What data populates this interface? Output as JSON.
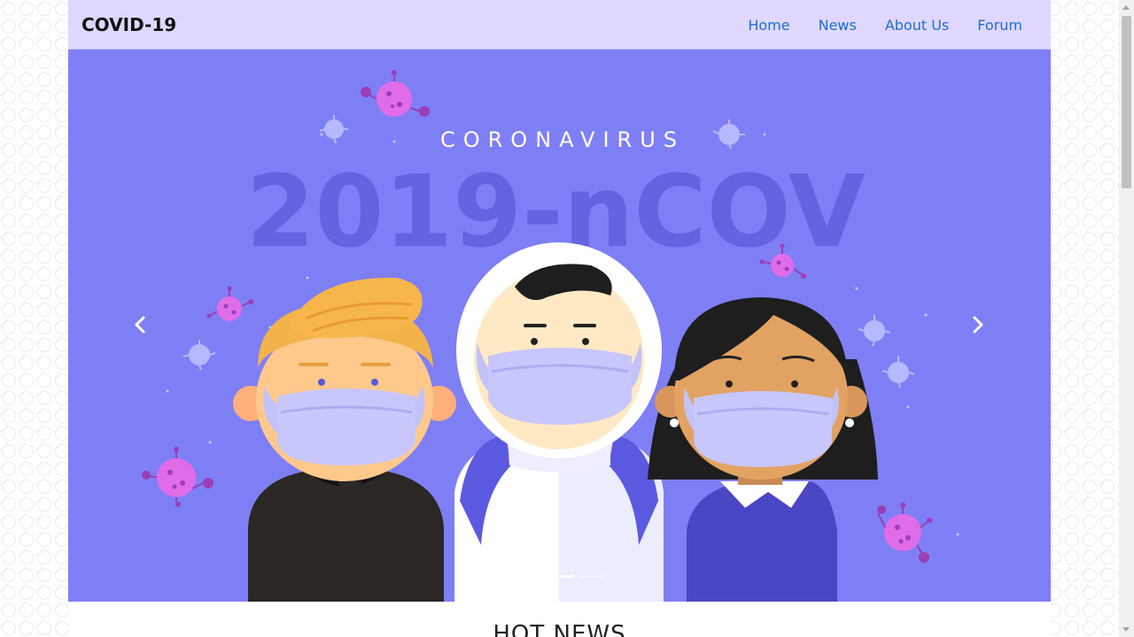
{
  "navbar": {
    "brand": "COVID-19",
    "links": [
      "Home",
      "News",
      "About Us",
      "Forum"
    ]
  },
  "hero": {
    "subtitle": "CORONAVIRUS",
    "headline": "2019-nCOV",
    "prev_icon": "chevron-left-icon",
    "next_icon": "chevron-right-icon",
    "slide_count": 3,
    "active_slide": 1
  },
  "section": {
    "title": "HOT NEWS"
  },
  "colors": {
    "navbar_bg": "#e0d7ff",
    "hero_bg": "#7f7ff5",
    "headline": "#6464e0",
    "virus_pink": "#e06ce8",
    "virus_light": "#b8b8ff",
    "link": "#1a6fd0"
  }
}
